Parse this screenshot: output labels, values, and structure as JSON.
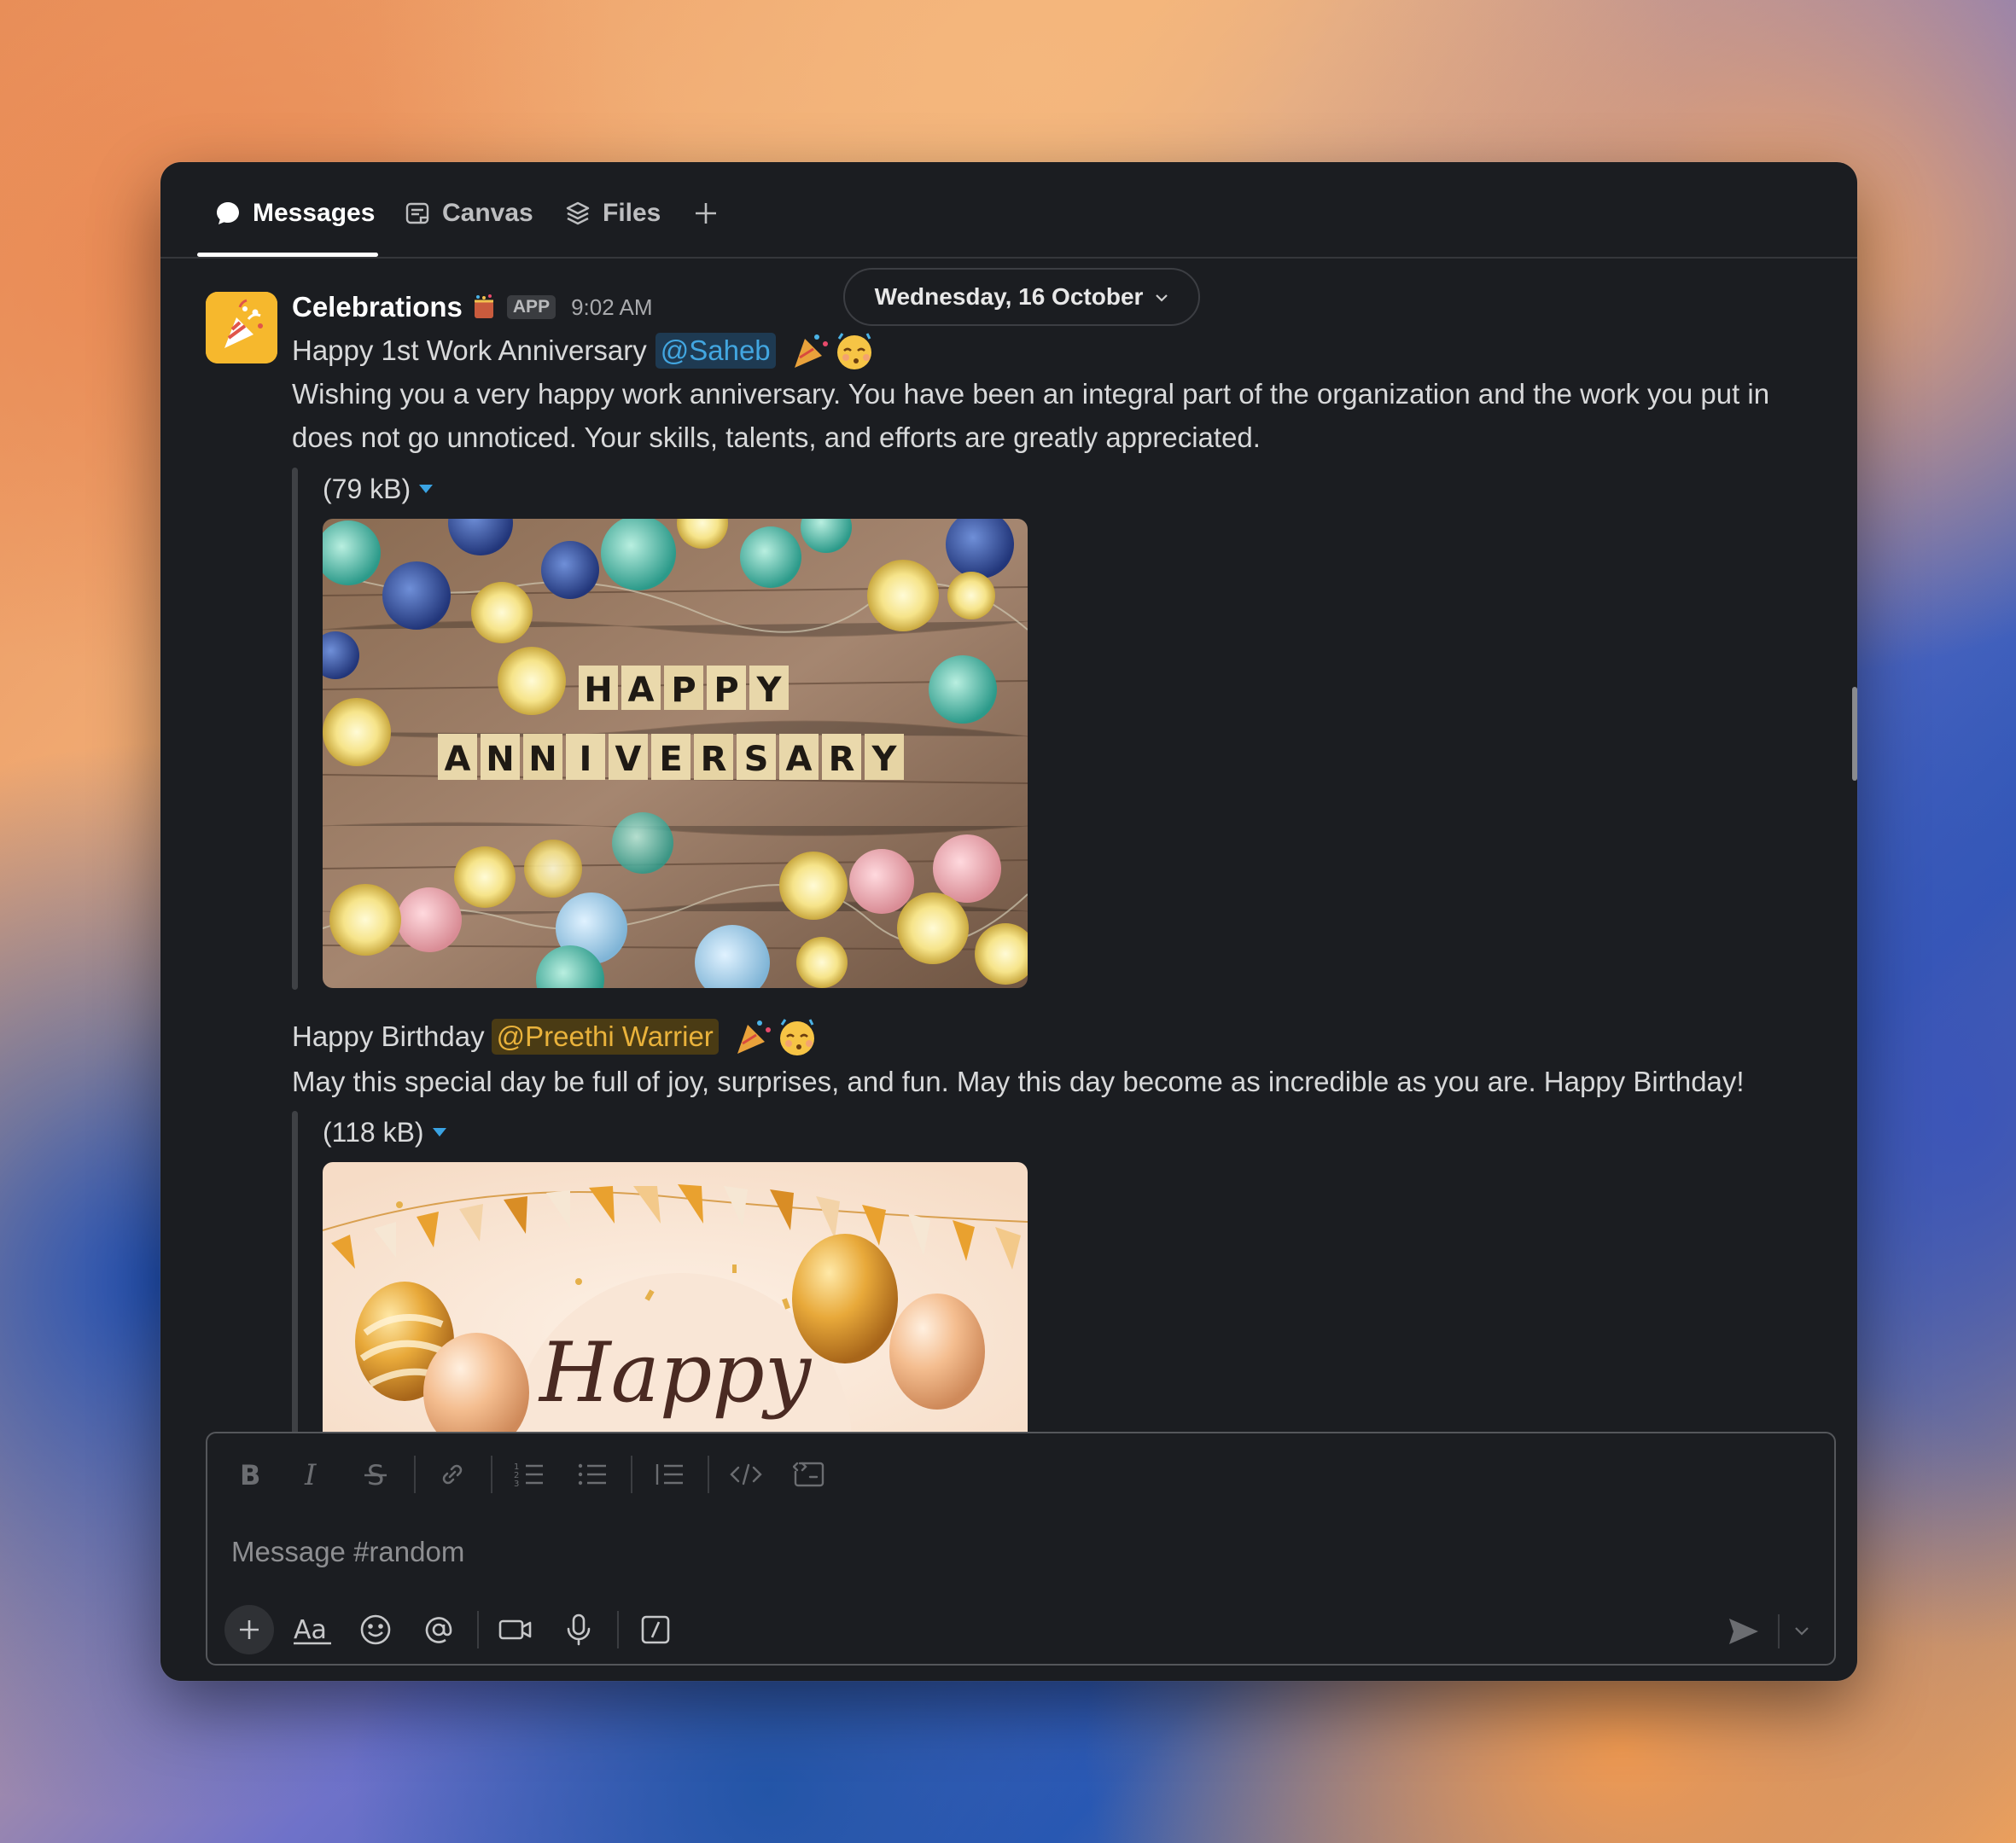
{
  "tabs": [
    {
      "label": "Messages",
      "icon": "chat-bubble-icon"
    },
    {
      "label": "Canvas",
      "icon": "canvas-icon"
    },
    {
      "label": "Files",
      "icon": "layers-icon"
    }
  ],
  "date_divider": {
    "label": "Wednesday, 16 October"
  },
  "message": {
    "sender": "Celebrations",
    "badge": "APP",
    "time": "9:02 AM",
    "anniversary": {
      "title": "Happy 1st Work Anniversary",
      "mention": "@Saheb",
      "body": "Wishing you a very happy work anniversary. You have been an integral part of the organization and the work you put in does not go unnoticed. Your skills, talents, and efforts are greatly appreciated.",
      "file_size": "(79 kB)",
      "image_text": [
        "HAPPY",
        "ANNIVERSARY"
      ]
    },
    "birthday": {
      "title": "Happy Birthday",
      "mention": "@Preethi Warrier",
      "body": "May this special day be full of joy, surprises, and fun. May this day become as incredible as you are. Happy Birthday!",
      "file_size": "(118 kB)",
      "image_text": "Happy"
    }
  },
  "composer": {
    "placeholder": "Message #random"
  },
  "colors": {
    "window_bg": "#1b1d21",
    "mention_blue": "#42a6e0",
    "mention_gold": "#e9b23b",
    "avatar_bg": "#f6b82d"
  }
}
